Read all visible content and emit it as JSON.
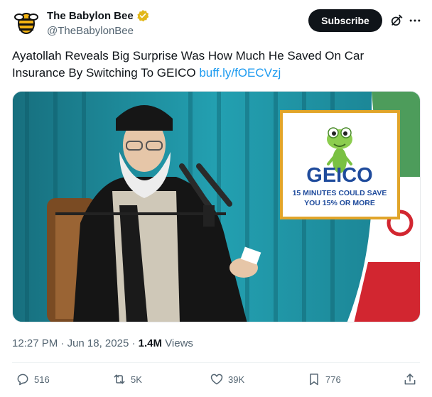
{
  "author": {
    "name": "The Babylon Bee",
    "handle": "@TheBabylonBee",
    "verified_color": "#e2b719"
  },
  "header": {
    "subscribe_label": "Subscribe",
    "icons": [
      "grok-icon",
      "more-icon"
    ]
  },
  "tweet": {
    "text": "Ayatollah Reveals Big Surprise Was How Much He Saved On Car Insurance By Switching To GEICO ",
    "link": "buff.ly/fOECVzj",
    "link_color": "#1d9bf0"
  },
  "media": {
    "ad": {
      "brand": "GEICO",
      "line1": "15 MINUTES COULD SAVE",
      "line2": "YOU 15% OR MORE",
      "brand_color": "#1f4b9c",
      "border_color": "#e1a52a"
    }
  },
  "meta": {
    "time": "12:27 PM",
    "date": "Jun 18, 2025",
    "views_count": "1.4M",
    "views_label": "Views"
  },
  "actions": {
    "replies": "516",
    "reposts": "5K",
    "likes": "39K",
    "bookmarks": "776"
  }
}
